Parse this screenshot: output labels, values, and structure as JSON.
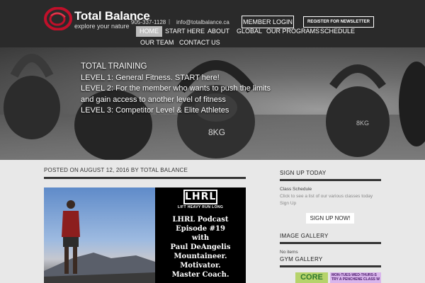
{
  "header": {
    "brand_name": "Total Balance",
    "tagline": "explore your nature",
    "phone": "905-337-1128",
    "separator": "|",
    "email": "info@totalbalance.ca",
    "member_login": "MEMBER LOGIN",
    "newsletter": "REGISTER FOR NEWSLETTER"
  },
  "nav": {
    "items": [
      {
        "label": "HOME"
      },
      {
        "label": "START HERE"
      },
      {
        "label": "ABOUT"
      },
      {
        "label": "GLOBAL"
      },
      {
        "label": "OUR PROGRAMS"
      },
      {
        "label": "SCHEDULE"
      },
      {
        "label": "OUR TEAM"
      },
      {
        "label": "CONTACT US"
      }
    ],
    "active_index": 0
  },
  "hero": {
    "title": "TOTAL TRAINING",
    "lines": [
      "LEVEL 1: General Fitness. START here!",
      "LEVEL 2: For the member who wants to push the limits and gain access to another level of fitness",
      "LEVEL 3: Competitor Level & Elite Athletes"
    ],
    "kettlebell_labels": [
      "8KG",
      "8KG"
    ]
  },
  "post": {
    "meta": "POSTED ON AUGUST 12, 2016 BY TOTAL BALANCE",
    "image": {
      "logo": "LHRL",
      "logo_sub": "LIFT HEAVY RUN LONG",
      "podcast_lines": [
        "LHRL Podcast",
        "Episode #19",
        "with",
        "Paul DeAngelis",
        "Mountaineer.",
        "Motivator.",
        "Master Coach."
      ]
    }
  },
  "sidebar": {
    "signup_title": "SIGN UP TODAY",
    "class_schedule": "Class Schedule",
    "class_desc": "Click to see a list of our various classes today",
    "sign_up_link": "Sign Up",
    "signup_button": "SIGN UP NOW!",
    "gallery_title": "IMAGE GALLERY",
    "no_items": "No items",
    "gym_gallery_title": "GYM GALLERY",
    "thumb1_text": "CORE",
    "thumb2_text": "MON-TUES-WED-THURS-S TRY A PENCHENE CLASS W"
  },
  "colors": {
    "header_bg": "#2a2a2a",
    "logo_red": "#c0102a",
    "page_bg": "#e8e8e8",
    "accent_rule": "#333333"
  }
}
